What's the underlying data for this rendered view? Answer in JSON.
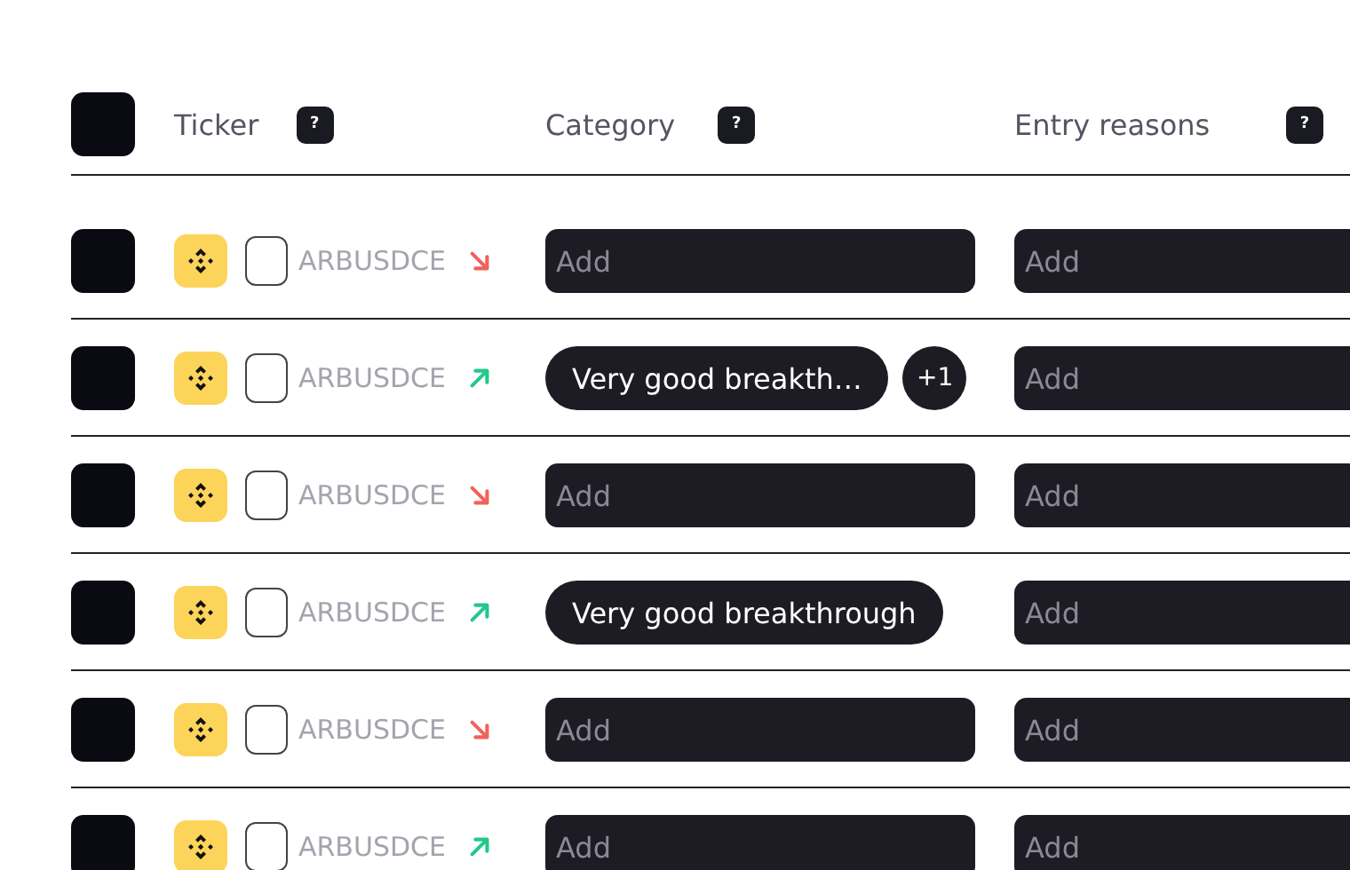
{
  "all_selected": false,
  "columns": [
    {
      "label": "Ticker",
      "help": "?"
    },
    {
      "label": "Category",
      "help": "?"
    },
    {
      "label": "Entry reasons",
      "help": "?"
    }
  ],
  "rows": [
    {
      "selected": false,
      "checked": false,
      "ticker": "ARBUSDCE",
      "kind": "down",
      "category": {
        "placeholder": "Add"
      },
      "entry_reasons": {
        "placeholder": "Add"
      }
    },
    {
      "selected": false,
      "checked": false,
      "ticker": "ARBUSDCE",
      "kind": "up",
      "category": {
        "tags": [
          "Very good breakth…"
        ],
        "more": "+1"
      },
      "entry_reasons": {
        "placeholder": "Add"
      }
    },
    {
      "selected": false,
      "checked": false,
      "ticker": "ARBUSDCE",
      "kind": "down",
      "category": {
        "placeholder": "Add"
      },
      "entry_reasons": {
        "placeholder": "Add"
      }
    },
    {
      "selected": false,
      "checked": false,
      "ticker": "ARBUSDCE",
      "kind": "up",
      "category": {
        "tags": [
          "Very good breakthrough"
        ]
      },
      "entry_reasons": {
        "placeholder": "Add"
      }
    },
    {
      "selected": false,
      "checked": false,
      "ticker": "ARBUSDCE",
      "kind": "down",
      "category": {
        "placeholder": "Add"
      },
      "entry_reasons": {
        "placeholder": "Add"
      }
    },
    {
      "selected": false,
      "checked": false,
      "ticker": "ARBUSDCE",
      "kind": "up",
      "category": {
        "placeholder": "Add"
      },
      "entry_reasons": {
        "placeholder": "Add"
      }
    }
  ]
}
